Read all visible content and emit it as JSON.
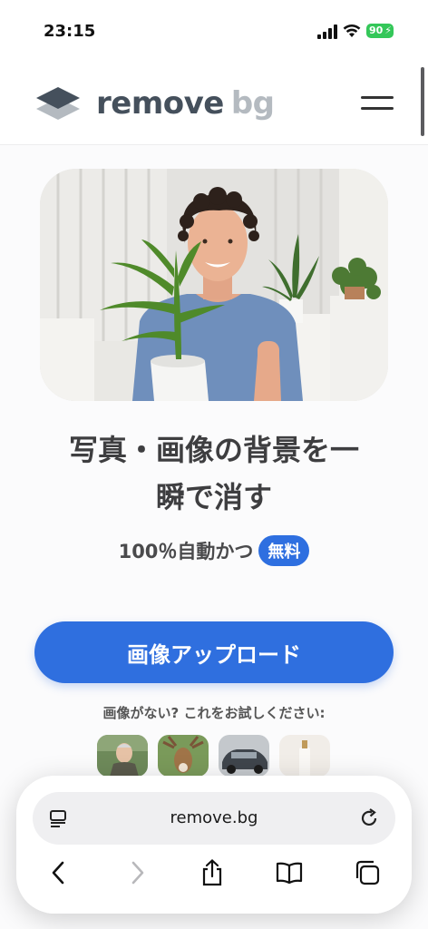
{
  "status_bar": {
    "time": "23:15",
    "battery": "90"
  },
  "header": {
    "logo_part1": "remove",
    "logo_part2": "bg"
  },
  "hero": {
    "title_line1": "写真・画像の背景を一",
    "title_line2": "瞬で消す",
    "subtitle": "100％自動かつ",
    "free_badge": "無料"
  },
  "upload": {
    "button_label": "画像アップロード"
  },
  "samples": {
    "prompt": "画像がない? これをお試しください:"
  },
  "browser": {
    "url": "remove.bg"
  },
  "colors": {
    "accent": "#2f6fdf",
    "battery": "#34c759",
    "logo_dark": "#45505c",
    "logo_light": "#b4bac0"
  }
}
